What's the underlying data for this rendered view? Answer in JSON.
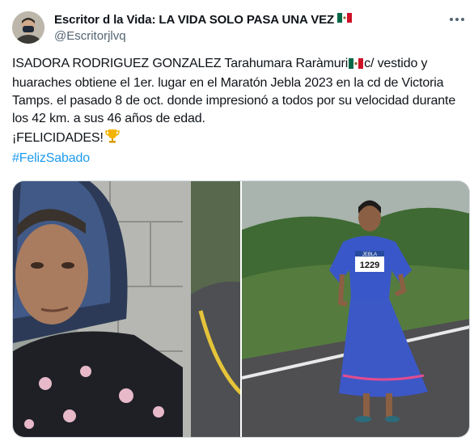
{
  "author": {
    "display_name": "Escritor d la Vida: LA VIDA SOLO PASA UNA VEZ",
    "flag_icon": "mexico-flag-icon",
    "handle": "@Escritorjlvq"
  },
  "tweet": {
    "text_line1": "ISADORA RODRIGUEZ GONZALEZ  Tarahumara Raràmuri",
    "text_after_flag": "c/ vestido y huaraches obtiene el 1er. lugar en el Maratón Jebla 2023 en la cd de Victoria Tamps. el pasado 8 de oct. donde impresionó a todos por su velocidad durante los 42 km. a sus 46 años de edad.",
    "celebration": "¡FELICIDADES!",
    "celebration_icon": "trophy-icon",
    "hashtag": "#FelizSabado"
  },
  "media": {
    "photos": [
      {
        "icon": "portrait-photo"
      },
      {
        "icon": "runner-photo",
        "bib_text": "1229",
        "bib_header": "JEBLA"
      }
    ]
  },
  "colors": {
    "link": "#1d9bf0",
    "secondary_text": "#536471",
    "border": "#cfd9de"
  }
}
